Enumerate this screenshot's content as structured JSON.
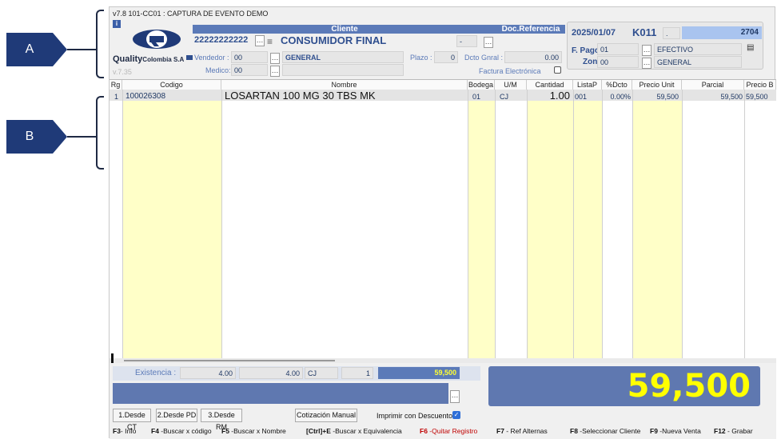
{
  "annotations": {
    "a": "A",
    "b": "B"
  },
  "window": {
    "title": "v7.8 101-CC01 : CAPTURA DE EVENTO DEMO",
    "version": "v.7.35"
  },
  "logo": {
    "brand": "Quality",
    "brand_sub": "Colombia S.A"
  },
  "cliente": {
    "header": "Cliente",
    "nit": "22222222222",
    "nombre": "CONSUMIDOR FINAL",
    "vendedor_label": "Vendedor :",
    "vendedor_code": "00",
    "vendedor_name": "GENERAL",
    "medico_label": "Medico:",
    "medico_code": "00",
    "plazo_label": "Plazo :",
    "plazo_value": "0",
    "dcto_label": "Dcto Gnral :",
    "dcto_value": "0.00",
    "factura_label": "Factura Electrónica"
  },
  "docref": {
    "header": "Doc.Referencia",
    "value": "-"
  },
  "doc": {
    "date": "2025/01/07",
    "code": "K011",
    "sep": ".",
    "number": "2704",
    "fpago_label": "F. Pago",
    "fpago_code": "01",
    "fpago_name": "EFECTIVO",
    "zona_label": "Zona",
    "zona_code": "00",
    "zona_name": "GENERAL"
  },
  "grid": {
    "headers": [
      "Rg",
      "Codigo",
      "Nombre",
      "Bodega",
      "U/M",
      "Cantidad",
      "ListaP",
      "%Dcto",
      "Precio Unit",
      "Parcial",
      "Precio B"
    ],
    "rows": [
      {
        "rg": "1",
        "codigo": "100026308",
        "nombre": "LOSARTAN 100 MG 30 TBS MK",
        "bodega": "01",
        "um": "CJ",
        "cantidad": "1.00",
        "listap": "001",
        "dcto": "0.00%",
        "precio_unit": "59,500",
        "parcial": "59,500",
        "precio_b": "59,500"
      }
    ]
  },
  "existencia": {
    "label": "Existencia :",
    "v1": "4.00",
    "v2": "4.00",
    "um": "CJ",
    "count": "1",
    "subtotal": "59,500"
  },
  "total": "59,500",
  "buttons": {
    "desde_ct": "1.Desde CT",
    "desde_pd": "2.Desde PD",
    "desde_rm": "3.Desde RM",
    "cotizacion": "Cotización Manual",
    "imprimir": "Imprimir con Descuento"
  },
  "fkeys": [
    {
      "key": "F3",
      "text": "- Info"
    },
    {
      "key": "F4",
      "text": " -Buscar x código"
    },
    {
      "key": "F5",
      "text": " -Buscar x Nombre"
    },
    {
      "key": "[Ctrl]+E",
      "text": " -Buscar x Equivalencia"
    },
    {
      "key": "F6",
      "text": " -Quitar Registro"
    },
    {
      "key": "F7",
      "text": " - Ref Alternas"
    },
    {
      "key": "F8",
      "text": " -Seleccionar Cliente"
    },
    {
      "key": "F9",
      "text": " -Nueva Venta"
    },
    {
      "key": "F12",
      "text": " - Grabar"
    }
  ],
  "colors": {
    "accent": "#5b7ab8",
    "total_bg": "#5f78b0",
    "total_fg": "#ffff00",
    "yellow_col": "#ffffc8"
  }
}
